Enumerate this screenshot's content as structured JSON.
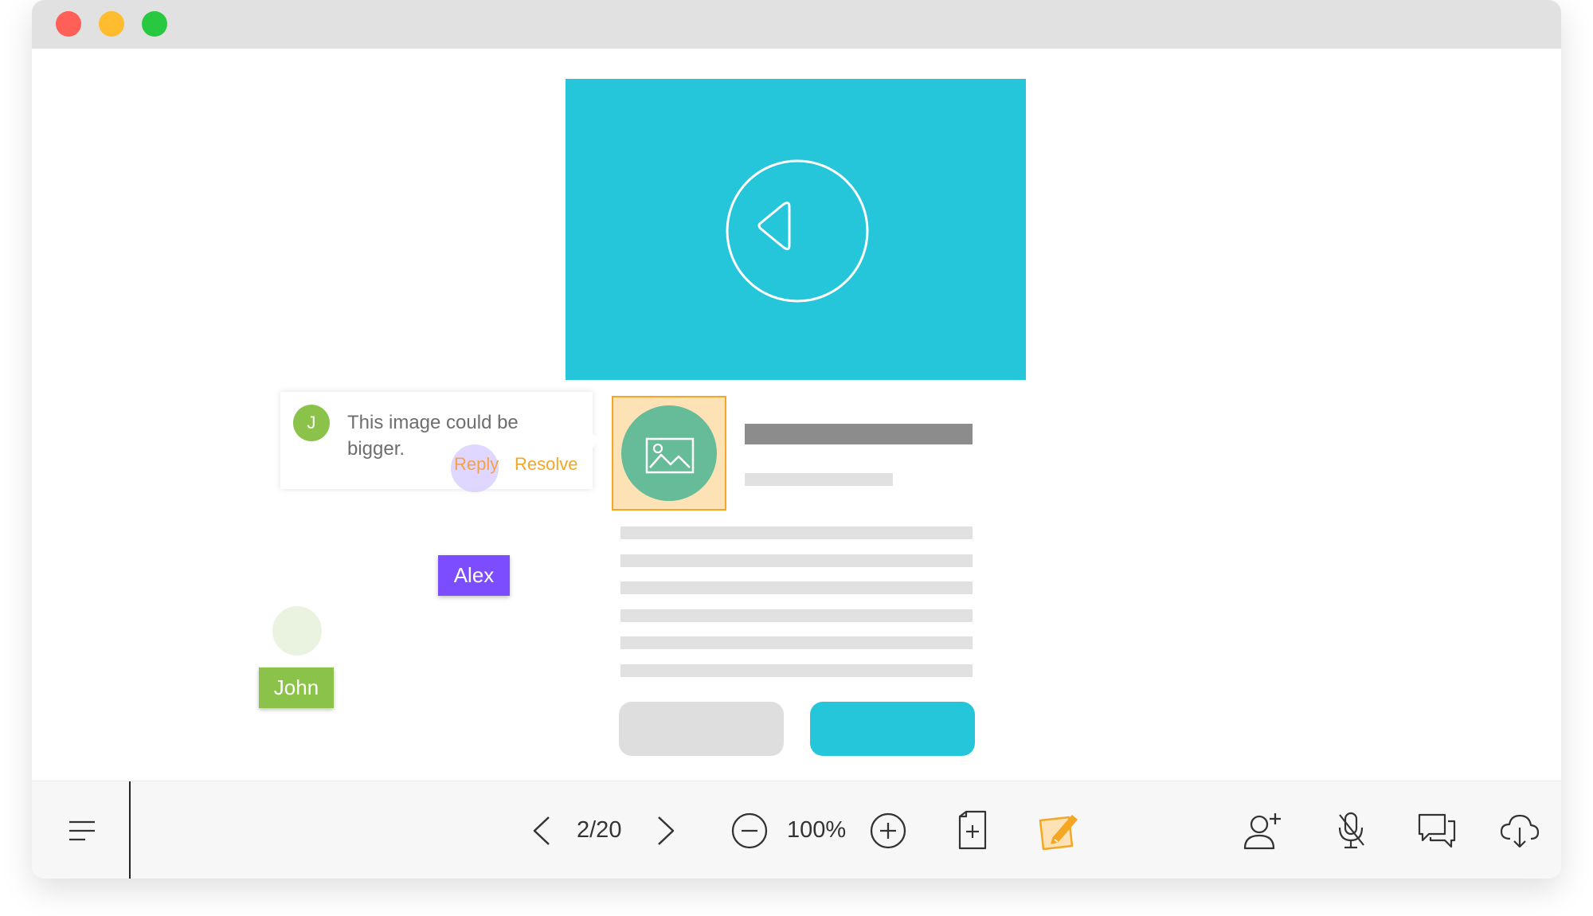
{
  "window": {
    "controls": [
      "close",
      "minimize",
      "zoom"
    ]
  },
  "comment": {
    "avatar_initial": "J",
    "text": "This image could be bigger.",
    "reply_label": "Reply",
    "resolve_label": "Resolve"
  },
  "collaborators": [
    {
      "name": "Alex",
      "color": "#7c4dff"
    },
    {
      "name": "John",
      "color": "#8bc34a"
    }
  ],
  "toolbar": {
    "page_indicator": "2/20",
    "zoom_level": "100%",
    "icons": [
      "menu-icon",
      "prev-page-icon",
      "next-page-icon",
      "zoom-out-icon",
      "zoom-in-icon",
      "add-page-icon",
      "annotate-icon",
      "add-user-icon",
      "mic-muted-icon",
      "chat-icon",
      "cloud-download-icon"
    ]
  },
  "colors": {
    "accent": "#26c6da",
    "selection": "#f7a623",
    "image_placeholder": "#66bb98"
  }
}
